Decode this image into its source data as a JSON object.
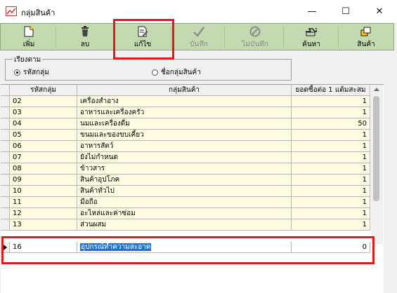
{
  "window": {
    "title": "กลุ่มสินค้า",
    "minimize_glyph": "—",
    "maximize_glyph": "☐",
    "close_glyph": "✕"
  },
  "toolbar": {
    "add_label": "เพิ่ม",
    "delete_label": "ลบ",
    "edit_label": "แก้ไข",
    "save_label": "บันทึก",
    "cancel_label": "ไม่บันทึก",
    "search_label": "ค้นหา",
    "product_label": "สินค้า"
  },
  "sort": {
    "legend": "เรียงตาม",
    "option_code": "รหัสกลุ่ม",
    "option_name": "ชื่อกลุ่มสินค้า",
    "selected": "option_code"
  },
  "grid": {
    "headers": {
      "code": "รหัสกลุ่ม",
      "name": "กลุ่มสินค้า",
      "min_qty": "ยอดซื้อต่อ 1 แต้มสะสม"
    },
    "rows": [
      {
        "code": "02",
        "name": "เครื่องสำอาง",
        "min_qty": "1"
      },
      {
        "code": "03",
        "name": "อาหารและเครื่องครัว",
        "min_qty": "1"
      },
      {
        "code": "04",
        "name": "นมและเครื่องดื่ม",
        "min_qty": "50"
      },
      {
        "code": "05",
        "name": "ขนมและของขบเคี้ยว",
        "min_qty": "1"
      },
      {
        "code": "06",
        "name": "อาหารสัตว์",
        "min_qty": "1"
      },
      {
        "code": "07",
        "name": "ยังไม่กำหนด",
        "min_qty": "1"
      },
      {
        "code": "08",
        "name": "ข้าวสาร",
        "min_qty": "1"
      },
      {
        "code": "09",
        "name": "สินค้าอุปโภค",
        "min_qty": "1"
      },
      {
        "code": "10",
        "name": "สินค้าทั่วไป",
        "min_qty": "1"
      },
      {
        "code": "11",
        "name": "มือถือ",
        "min_qty": "1"
      },
      {
        "code": "12",
        "name": "อะไหล่และค่าซ่อม",
        "min_qty": "1"
      },
      {
        "code": "13",
        "name": "ส่วนผสม",
        "min_qty": "1"
      }
    ],
    "new_row": {
      "code": "16",
      "name": "อุปกรณ์ทำความสะอาด",
      "min_qty": "0"
    }
  },
  "colors": {
    "toolbar_bg": "#c3d9b0",
    "row_bg": "#fffde1",
    "highlight": "#e0191f",
    "selection": "#1e6fd6"
  }
}
